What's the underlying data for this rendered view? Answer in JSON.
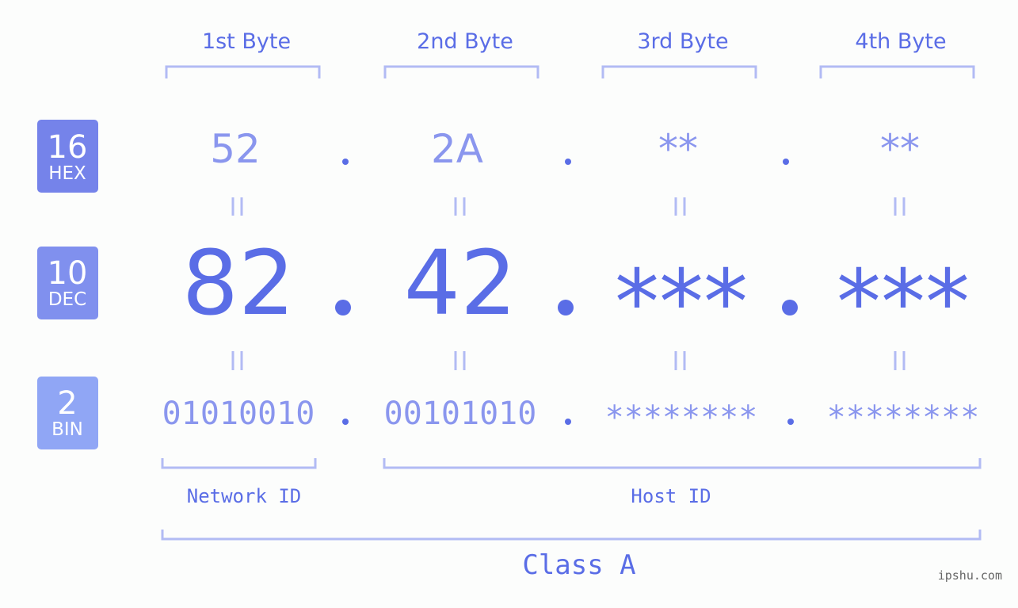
{
  "colors": {
    "primary": "#5a6de6",
    "light": "#8a96ee",
    "bracket": "#b2bbf4",
    "badge_hex": "#7583ea",
    "badge_dec": "#8090ee",
    "badge_bin": "#90a6f5",
    "background": "#fcfdfc"
  },
  "bytes": [
    {
      "header": "1st Byte",
      "hex": "52",
      "dec": "82",
      "bin": "01010010"
    },
    {
      "header": "2nd Byte",
      "hex": "2A",
      "dec": "42",
      "bin": "00101010"
    },
    {
      "header": "3rd Byte",
      "hex": "**",
      "dec": "***",
      "bin": "********"
    },
    {
      "header": "4th Byte",
      "hex": "**",
      "dec": "***",
      "bin": "********"
    }
  ],
  "badges": [
    {
      "number": "16",
      "label": "HEX"
    },
    {
      "number": "10",
      "label": "DEC"
    },
    {
      "number": "2",
      "label": "BIN"
    }
  ],
  "equals_symbol": "=",
  "separator": ".",
  "segments": {
    "network_id": "Network ID",
    "host_id": "Host ID"
  },
  "class_label": "Class A",
  "watermark": "ipshu.com"
}
